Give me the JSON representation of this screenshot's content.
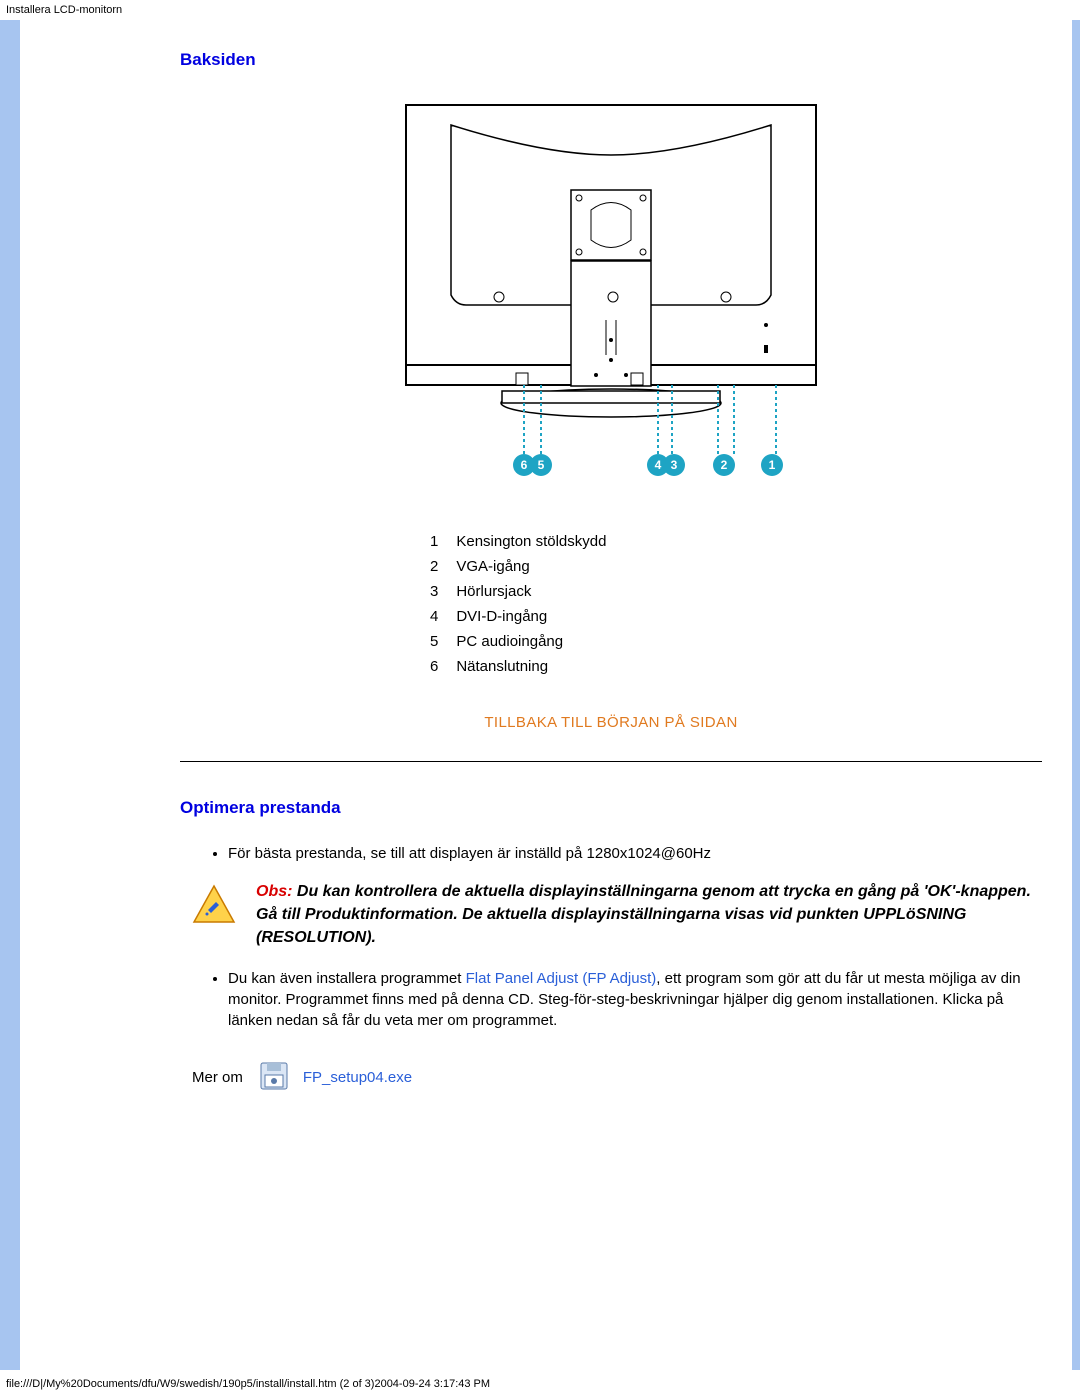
{
  "header_text": "Installera LCD-monitorn",
  "section_baksiden": "Baksiden",
  "legend": [
    {
      "num": "1",
      "label": "Kensington stöldskydd"
    },
    {
      "num": "2",
      "label": "VGA-igång"
    },
    {
      "num": "3",
      "label": "Hörlursjack"
    },
    {
      "num": "4",
      "label": "DVI-D-ingång"
    },
    {
      "num": "5",
      "label": "PC audioingång"
    },
    {
      "num": "6",
      "label": "Nätanslutning"
    }
  ],
  "back_to_top": "TILLBAKA TILL BÖRJAN PÅ SIDAN",
  "section_optimera": "Optimera prestanda",
  "bullet1": "För bästa prestanda, se till att displayen är inställd på 1280x1024@60Hz",
  "note": {
    "obs_label": "Obs:",
    "rest": " Du kan kontrollera de aktuella displayinställningarna genom att trycka en gång på 'OK'-knappen. Gå till Produktinformation. De aktuella displayinställningarna visas vid punkten UPPLöSNING (RESOLUTION)."
  },
  "bullet2_pre": "Du kan även installera programmet ",
  "bullet2_link": "Flat Panel Adjust (FP Adjust)",
  "bullet2_post": ", ett program som gör att du får ut mesta möjliga av din monitor. Programmet finns med på denna CD. Steg-för-steg-beskrivningar hjälper dig genom installationen. Klicka på länken nedan så får du veta mer om programmet.",
  "mer_om": "Mer om",
  "exe_name": "FP_setup04.exe",
  "footer": "file:///D|/My%20Documents/dfu/W9/swedish/190p5/install/install.htm (2 of 3)2004-09-24 3:17:43 PM"
}
